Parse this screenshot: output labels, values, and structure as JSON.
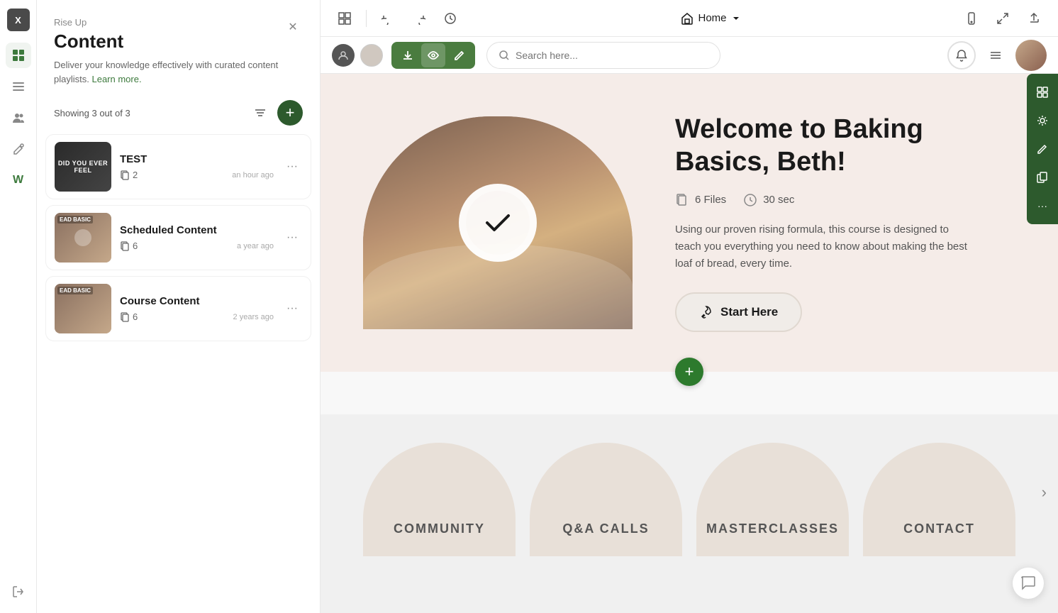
{
  "app": {
    "name": "Rise Up",
    "logo": "X"
  },
  "panel": {
    "title": "Content",
    "description": "Deliver your knowledge effectively with curated content playlists.",
    "learn_more": "Learn more.",
    "showing": "Showing 3 out of 3"
  },
  "content_items": [
    {
      "name": "TEST",
      "thumb_label": "DID YOU EVER FEEL",
      "files": 2,
      "time": "an hour ago",
      "thumb_type": "test"
    },
    {
      "name": "Scheduled Content",
      "thumb_label": "EAD BASIC",
      "files": 6,
      "time": "a year ago",
      "thumb_type": "bread"
    },
    {
      "name": "Course Content",
      "thumb_label": "EAD BASIC",
      "files": 6,
      "time": "2 years ago",
      "thumb_type": "bread"
    }
  ],
  "toolbar": {
    "home_label": "Home",
    "undo_icon": "↩",
    "redo_icon": "↪",
    "history_icon": "🕐",
    "layout_icon": "⊞",
    "arrow_down_icon": "↓",
    "eye_icon": "👁",
    "edit_icon": "✎",
    "mobile_icon": "📱",
    "expand_icon": "↗",
    "share_icon": "⬆"
  },
  "search": {
    "placeholder": "Search here..."
  },
  "hero": {
    "title": "Welcome to Baking Basics, Beth!",
    "files_count": "6 Files",
    "duration": "30 sec",
    "description": "Using our proven rising formula, this course is designed to teach you everything you need to know about making the best loaf of bread, every time.",
    "start_btn": "Start Here"
  },
  "nav_cards": [
    {
      "label": "COMMUNITY"
    },
    {
      "label": "Q&A CALLS"
    },
    {
      "label": "MASTERCLASSES"
    },
    {
      "label": "CONTACT"
    }
  ],
  "action_bar": {
    "download_icon": "↓",
    "eye_icon": "◉",
    "edit_icon": "✏"
  },
  "right_toolbar": {
    "icons": [
      "⊞",
      "⚙",
      "✏",
      "⧉",
      "···"
    ]
  },
  "colors": {
    "green_dark": "#2d5a2d",
    "green_action": "#4a7c3f",
    "hero_bg": "#f5ece8",
    "card_bg": "#e8e0d8"
  }
}
